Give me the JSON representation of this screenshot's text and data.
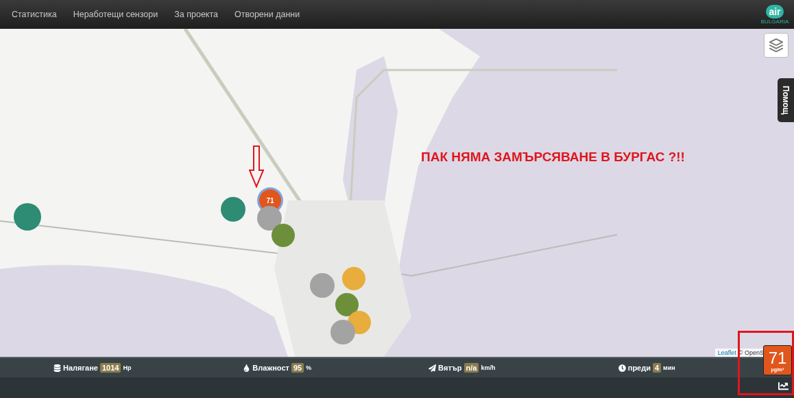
{
  "navbar": {
    "items": [
      "Статистика",
      "Неработещи сензори",
      "За проекта",
      "Отворени данни"
    ],
    "logo": {
      "mark": "air",
      "caption": "BULGARIA"
    }
  },
  "map": {
    "help_tab": "Помощ",
    "annotation": "ПАК НЯМА ЗАМЪРСЯВАНЕ В БУРГАС ?!!",
    "attribution": {
      "link": "Leaflet",
      "text": "© OpenS"
    },
    "markers": [
      {
        "color": "#2e8b74"
      },
      {
        "color": "#2e8b74"
      },
      {
        "color": "#e0561c",
        "label": "71",
        "selected": true
      },
      {
        "color": "#a3a3a3"
      },
      {
        "color": "#6d8f3c"
      },
      {
        "color": "#a3a3a3"
      },
      {
        "color": "#e8ad3c"
      },
      {
        "color": "#6d8f3c"
      },
      {
        "color": "#e8ad3c"
      },
      {
        "color": "#a3a3a3"
      }
    ]
  },
  "stats": [
    {
      "kind": "pressure",
      "label": "Налягане",
      "value": "1014",
      "unit": "Hp"
    },
    {
      "kind": "humidity",
      "label": "Влажност",
      "value": "95",
      "unit": "%"
    },
    {
      "kind": "wind",
      "label": "Вятър",
      "value": "n/a",
      "unit": "km/h"
    },
    {
      "kind": "time",
      "label": "преди",
      "value": "4",
      "unit": "мин"
    }
  ],
  "reading": {
    "value": "71",
    "unit": "µg/m³"
  }
}
